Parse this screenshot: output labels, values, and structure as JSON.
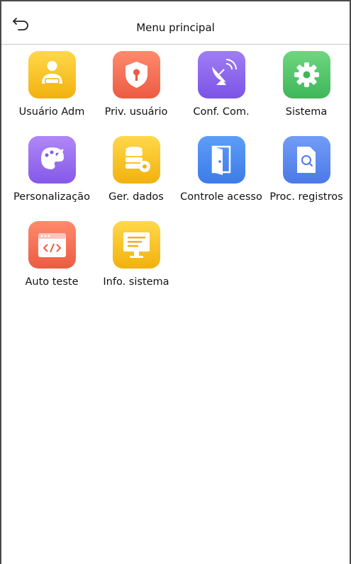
{
  "header": {
    "title": "Menu principal"
  },
  "menu": {
    "items": [
      {
        "label": "Usuário Adm",
        "icon": "admin-user-icon",
        "color": "#f6c21d"
      },
      {
        "label": "Priv. usuário",
        "icon": "shield-key-icon",
        "color": "#f36f55"
      },
      {
        "label": "Conf. Com.",
        "icon": "satellite-dish-icon",
        "color": "#8b66ee"
      },
      {
        "label": "Sistema",
        "icon": "gear-icon",
        "color": "#4fc46a"
      },
      {
        "label": "Personalização",
        "icon": "palette-icon",
        "color": "#9b6df0"
      },
      {
        "label": "Ger. dados",
        "icon": "database-gear-icon",
        "color": "#f6c21d"
      },
      {
        "label": "Controle acesso",
        "icon": "door-icon",
        "color": "#4c8ff2"
      },
      {
        "label": "Proc. registros",
        "icon": "document-search-icon",
        "color": "#5d8cf2"
      },
      {
        "label": "Auto teste",
        "icon": "code-window-icon",
        "color": "#f36f55"
      },
      {
        "label": "Info. sistema",
        "icon": "monitor-icon",
        "color": "#f6c21d"
      }
    ]
  }
}
